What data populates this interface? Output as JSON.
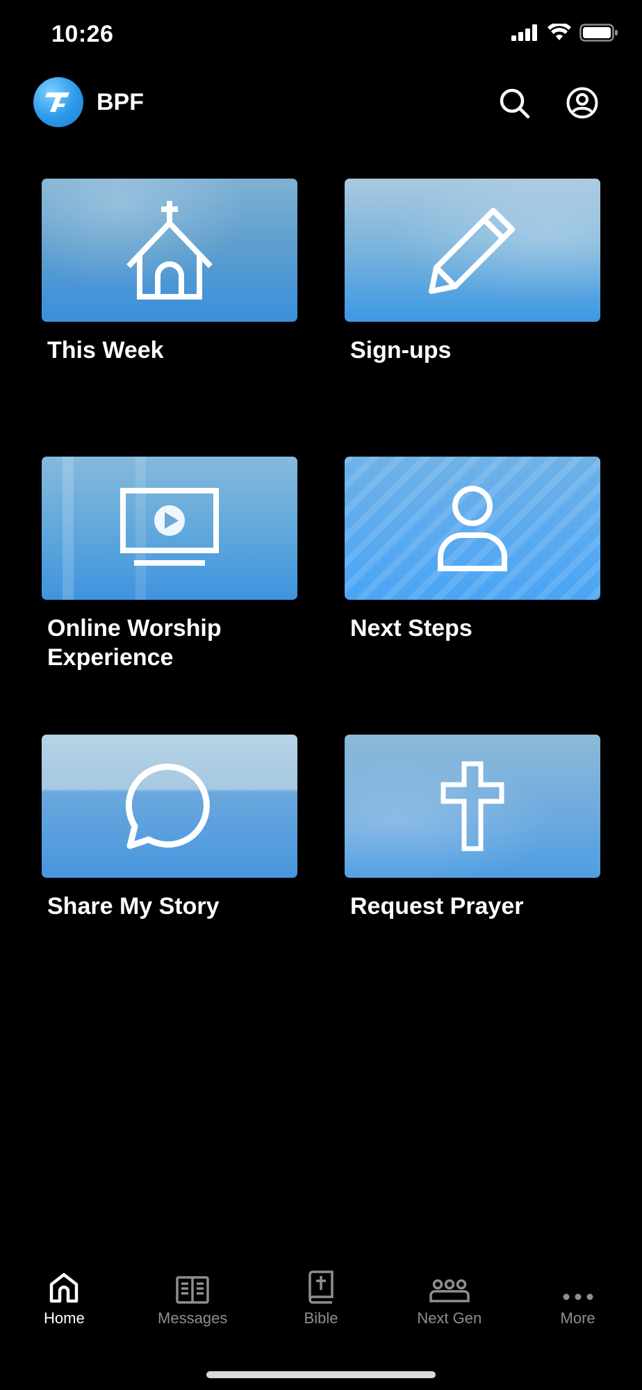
{
  "status_bar": {
    "time": "10:26"
  },
  "header": {
    "title": "BPF"
  },
  "tiles": [
    {
      "label": "This Week",
      "icon": "church-icon"
    },
    {
      "label": "Sign-ups",
      "icon": "pencil-icon"
    },
    {
      "label": "Online Worship Experience",
      "icon": "monitor-play-icon"
    },
    {
      "label": "Next Steps",
      "icon": "person-icon"
    },
    {
      "label": "Share My Story",
      "icon": "chat-bubble-icon"
    },
    {
      "label": "Request Prayer",
      "icon": "cross-icon"
    }
  ],
  "tab_bar": {
    "items": [
      {
        "label": "Home",
        "icon": "home-icon",
        "active": true
      },
      {
        "label": "Messages",
        "icon": "book-icon",
        "active": false
      },
      {
        "label": "Bible",
        "icon": "bible-icon",
        "active": false
      },
      {
        "label": "Next Gen",
        "icon": "group-icon",
        "active": false
      },
      {
        "label": "More",
        "icon": "more-icon",
        "active": false
      }
    ]
  },
  "colors": {
    "background": "#000000",
    "accent": "#2a98e9",
    "tab_inactive": "#8e8e93"
  }
}
